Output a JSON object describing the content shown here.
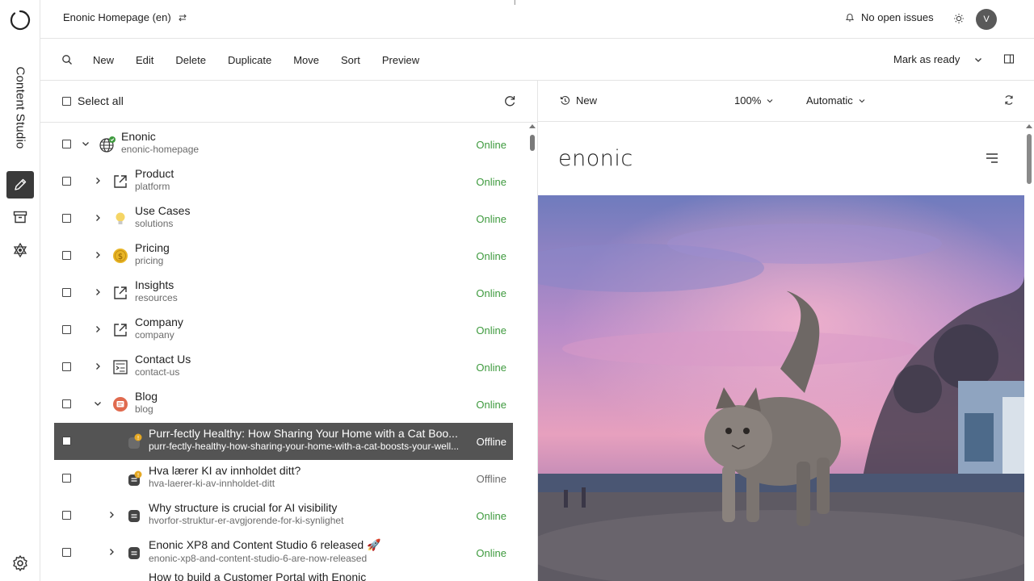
{
  "rail": {
    "app_name": "Content Studio",
    "nav": [
      {
        "icon": "pencil-icon",
        "active": true
      },
      {
        "icon": "archive-icon",
        "active": false
      },
      {
        "icon": "widget-network-icon",
        "active": false
      }
    ],
    "settings_icon": "gear-icon"
  },
  "header": {
    "project": "Enonic Homepage (en)",
    "issues": "No open issues",
    "avatar": "V"
  },
  "toolbar": {
    "actions": [
      "New",
      "Edit",
      "Delete",
      "Duplicate",
      "Move",
      "Sort",
      "Preview"
    ],
    "mark_ready": "Mark as ready"
  },
  "tree": {
    "select_all": "Select all",
    "rows": [
      {
        "title": "Enonic",
        "name": "enonic-homepage",
        "status": "Online",
        "icon": "globe-icon"
      },
      {
        "title": "Product",
        "name": "platform",
        "status": "Online",
        "icon": "shortcut-icon"
      },
      {
        "title": "Use Cases",
        "name": "solutions",
        "status": "Online",
        "icon": "lightbulb-icon"
      },
      {
        "title": "Pricing",
        "name": "pricing",
        "status": "Online",
        "icon": "coin-icon"
      },
      {
        "title": "Insights",
        "name": "resources",
        "status": "Online",
        "icon": "shortcut-icon"
      },
      {
        "title": "Company",
        "name": "company",
        "status": "Online",
        "icon": "shortcut-icon"
      },
      {
        "title": "Contact Us",
        "name": "contact-us",
        "status": "Online",
        "icon": "form-page-icon"
      },
      {
        "title": "Blog",
        "name": "blog",
        "status": "Online",
        "icon": "blog-icon"
      },
      {
        "title": "Purr-fectly Healthy: How Sharing Your Home with a Cat Boo...",
        "name": "purr-fectly-healthy-how-sharing-your-home-with-a-cat-boosts-your-well...",
        "status": "Offline",
        "icon": "article-icon"
      },
      {
        "title": "Hva lærer KI av innholdet ditt?",
        "name": "hva-laerer-ki-av-innholdet-ditt",
        "status": "Offline",
        "icon": "article-icon"
      },
      {
        "title": "Why structure is crucial for AI visibility",
        "name": "hvorfor-struktur-er-avgjorende-for-ki-synlighet",
        "status": "Online",
        "icon": "article-icon"
      },
      {
        "title": "Enonic XP8 and Content Studio 6 released 🚀",
        "name": "enonic-xp8-and-content-studio-6-are-now-released",
        "status": "Online",
        "icon": "article-icon"
      },
      {
        "title": "How to build a Customer Portal with Enonic",
        "name": "",
        "status": "",
        "icon": "article-icon"
      }
    ]
  },
  "preview": {
    "version": "New",
    "zoom": "100%",
    "mode": "Automatic",
    "site_logo": "enonic"
  },
  "colors": {
    "online": "#3e9a3e",
    "selected_row": "#545454",
    "avatar": "#595959"
  }
}
